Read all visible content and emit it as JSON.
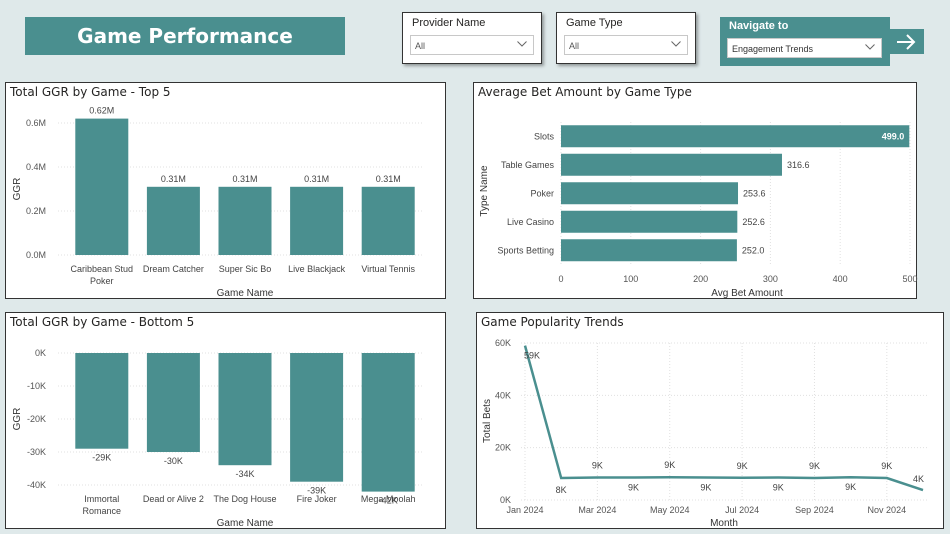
{
  "header": {
    "title": "Game Performance"
  },
  "slicers": [
    {
      "label": "Provider Name",
      "value": "All"
    },
    {
      "label": "Game Type",
      "value": "All"
    }
  ],
  "navigate": {
    "label": "Navigate to",
    "value": "Engagement Trends",
    "button_icon": "arrow-right-icon"
  },
  "colors": {
    "bar": "#4a8f8f",
    "background": "#dfe9ea",
    "grid": "#e0e0e0"
  },
  "top5": {
    "title": "Total GGR by Game - Top 5",
    "chart_data": {
      "type": "bar",
      "title": "Total GGR by Game - Top 5",
      "xlabel": "Game Name",
      "ylabel": "GGR",
      "categories": [
        [
          "Caribbean Stud",
          "Poker"
        ],
        [
          "Dream Catcher"
        ],
        [
          "Super Sic Bo"
        ],
        [
          "Live Blackjack"
        ],
        [
          "Virtual Tennis"
        ]
      ],
      "values": [
        0.62,
        0.31,
        0.31,
        0.31,
        0.31
      ],
      "data_labels": [
        "0.62M",
        "0.31M",
        "0.31M",
        "0.31M",
        "0.31M"
      ],
      "yticks": [
        0,
        0.2,
        0.4,
        0.6
      ],
      "ytick_labels": [
        "0.0M",
        "0.2M",
        "0.4M",
        "0.6M"
      ],
      "ylim": [
        0,
        0.6
      ]
    }
  },
  "bottom5": {
    "title": "Total GGR by Game - Bottom 5",
    "chart_data": {
      "type": "bar",
      "title": "Total GGR by Game - Bottom 5",
      "xlabel": "Game Name",
      "ylabel": "GGR",
      "categories": [
        [
          "Immortal",
          "Romance"
        ],
        [
          "Dead or Alive 2"
        ],
        [
          "The Dog House"
        ],
        [
          "Fire Joker"
        ],
        [
          "Mega Moolah"
        ]
      ],
      "values": [
        -29,
        -30,
        -34,
        -39,
        -42
      ],
      "data_labels": [
        "-29K",
        "-30K",
        "-34K",
        "-39K",
        "-42K"
      ],
      "yticks": [
        0,
        -10,
        -20,
        -30,
        -40
      ],
      "ytick_labels": [
        "0K",
        "-10K",
        "-20K",
        "-30K",
        "-40K"
      ],
      "ylim": [
        -40,
        0
      ]
    }
  },
  "avgbet": {
    "title": "Average Bet Amount by Game Type",
    "chart_data": {
      "type": "bar",
      "orientation": "horizontal",
      "title": "Average Bet Amount by Game Type",
      "xlabel": "Avg Bet Amount",
      "ylabel": "Type Name",
      "categories": [
        "Slots",
        "Table Games",
        "Poker",
        "Live Casino",
        "Sports Betting"
      ],
      "values": [
        499.0,
        316.6,
        253.6,
        252.6,
        252.0
      ],
      "data_labels": [
        "499.0",
        "316.6",
        "253.6",
        "252.6",
        "252.0"
      ],
      "xticks": [
        0,
        100,
        200,
        300,
        400,
        500
      ],
      "xtick_labels": [
        "0",
        "100",
        "200",
        "300",
        "400",
        "500"
      ],
      "xlim": [
        0,
        500
      ]
    }
  },
  "popularity": {
    "title": "Game Popularity Trends",
    "chart_data": {
      "type": "line",
      "title": "Game Popularity Trends",
      "xlabel": "Month",
      "ylabel": "Total Bets",
      "x": [
        "Jan 2024",
        "Feb 2024",
        "Mar 2024",
        "Apr 2024",
        "May 2024",
        "Jun 2024",
        "Jul 2024",
        "Aug 2024",
        "Sep 2024",
        "Oct 2024",
        "Nov 2024",
        "Dec 2024"
      ],
      "values": [
        59,
        8.4,
        8.6,
        8.6,
        8.7,
        8.6,
        8.5,
        8.6,
        8.4,
        8.7,
        8.4,
        3.8
      ],
      "data_labels": [
        "59K",
        "8K",
        "9K",
        "9K",
        "9K",
        "9K",
        "9K",
        "9K",
        "9K",
        "9K",
        "9K",
        "4K"
      ],
      "xtick_labels": [
        "Jan 2024",
        "Mar 2024",
        "May 2024",
        "Jul 2024",
        "Sep 2024",
        "Nov 2024"
      ],
      "yticks": [
        0,
        20,
        40,
        60
      ],
      "ytick_labels": [
        "0K",
        "20K",
        "40K",
        "60K"
      ],
      "ylim": [
        0,
        60
      ]
    }
  }
}
